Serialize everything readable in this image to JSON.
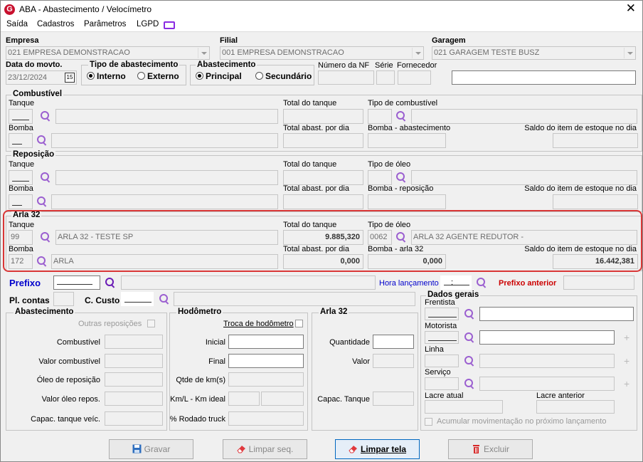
{
  "window": {
    "title": "ABA - Abastecimento / Velocímetro",
    "close": "✕",
    "logo": "G"
  },
  "menu": [
    "Saída",
    "Cadastros",
    "Parâmetros",
    "LGPD"
  ],
  "header": {
    "empresa_label": "Empresa",
    "empresa_value": "021 EMPRESA DEMONSTRACAO",
    "filial_label": "Filial",
    "filial_value": "001 EMPRESA DEMONSTRACAO",
    "garagem_label": "Garagem",
    "garagem_value": "021 GARAGEM TESTE BUSZ",
    "data_label": "Data do movto.",
    "data_value": "23/12/2024",
    "cal": "15",
    "tipo_label": "Tipo de abastecimento",
    "tipo_opt1": "Interno",
    "tipo_opt2": "Externo",
    "abast_label": "Abastecimento",
    "abast_opt1": "Principal",
    "abast_opt2": "Secundário",
    "nf_label": "Número da NF",
    "serie_label": "Série",
    "fornecedor_label": "Fornecedor"
  },
  "combustivel": {
    "title": "Combustível",
    "tanque": "Tanque",
    "total_tanque": "Total do tanque",
    "tipo": "Tipo de combustível",
    "bomba": "Bomba",
    "total_dia": "Total abast. por dia",
    "bomba_abast": "Bomba - abastecimento",
    "saldo": "Saldo do item de estoque no dia"
  },
  "reposicao": {
    "title": "Reposição",
    "tanque": "Tanque",
    "total_tanque": "Total do tanque",
    "tipo": "Tipo de óleo",
    "bomba": "Bomba",
    "total_dia": "Total abast. por dia",
    "bomba_abast": "Bomba - reposição",
    "saldo": "Saldo do item de estoque no dia"
  },
  "arla": {
    "title": "Arla 32",
    "tanque": "Tanque",
    "tanque_code": "99",
    "tanque_desc": "ARLA 32 - TESTE SP",
    "total_tanque": "Total do tanque",
    "total_tanque_value": "9.885,320",
    "tipo": "Tipo de óleo",
    "tipo_code": "0062",
    "tipo_desc": "ARLA 32 AGENTE REDUTOR -",
    "bomba": "Bomba",
    "bomba_code": "172",
    "bomba_desc": "ARLA",
    "total_dia": "Total abast. por dia",
    "total_dia_value": "0,000",
    "bomba_abast": "Bomba - arla 32",
    "bomba_abast_value": "0,000",
    "saldo": "Saldo do item de estoque no dia",
    "saldo_value": "16.442,381"
  },
  "prefixo": {
    "label": "Prefixo",
    "hora_label": "Hora lançamento",
    "hora_value": ":",
    "anterior_label": "Prefixo anterior",
    "pl_contas": "Pl. contas",
    "c_custo": "C. Custo"
  },
  "abastecimento": {
    "title": "Abastecimento",
    "outras": "Outras reposições",
    "combustivel": "Combustível",
    "valor_comb": "Valor combustível",
    "oleo_rep": "Óleo de reposição",
    "valor_oleo": "Valor óleo repos.",
    "capac": "Capac. tanque veíc."
  },
  "hodometro": {
    "title": "Hodômetro",
    "troca": "Troca de hodômetro",
    "inicial": "Inicial",
    "final": "Final",
    "qtde": "Qtde de km(s)",
    "kml": "Km/L - Km ideal",
    "rodado": "% Rodado truck"
  },
  "arla_box": {
    "title": "Arla 32",
    "quantidade": "Quantidade",
    "valor": "Valor",
    "capac": "Capac. Tanque"
  },
  "dados": {
    "title": "Dados gerais",
    "frentista": "Frentista",
    "motorista": "Motorista",
    "linha": "Linha",
    "servico": "Serviço",
    "lacre_atual": "Lacre atual",
    "lacre_anterior": "Lacre anterior",
    "acumular": "Acumular movimentação no próximo lançamento"
  },
  "buttons": {
    "gravar": "Gravar",
    "limpar_seq": "Limpar seq.",
    "limpar_tela": "Limpar tela",
    "excluir": "Excluir"
  },
  "colors": {
    "accent": "#0067c0",
    "prefixo": "#0000cc",
    "anterior": "#cc0000",
    "highlight": "#d93636"
  }
}
